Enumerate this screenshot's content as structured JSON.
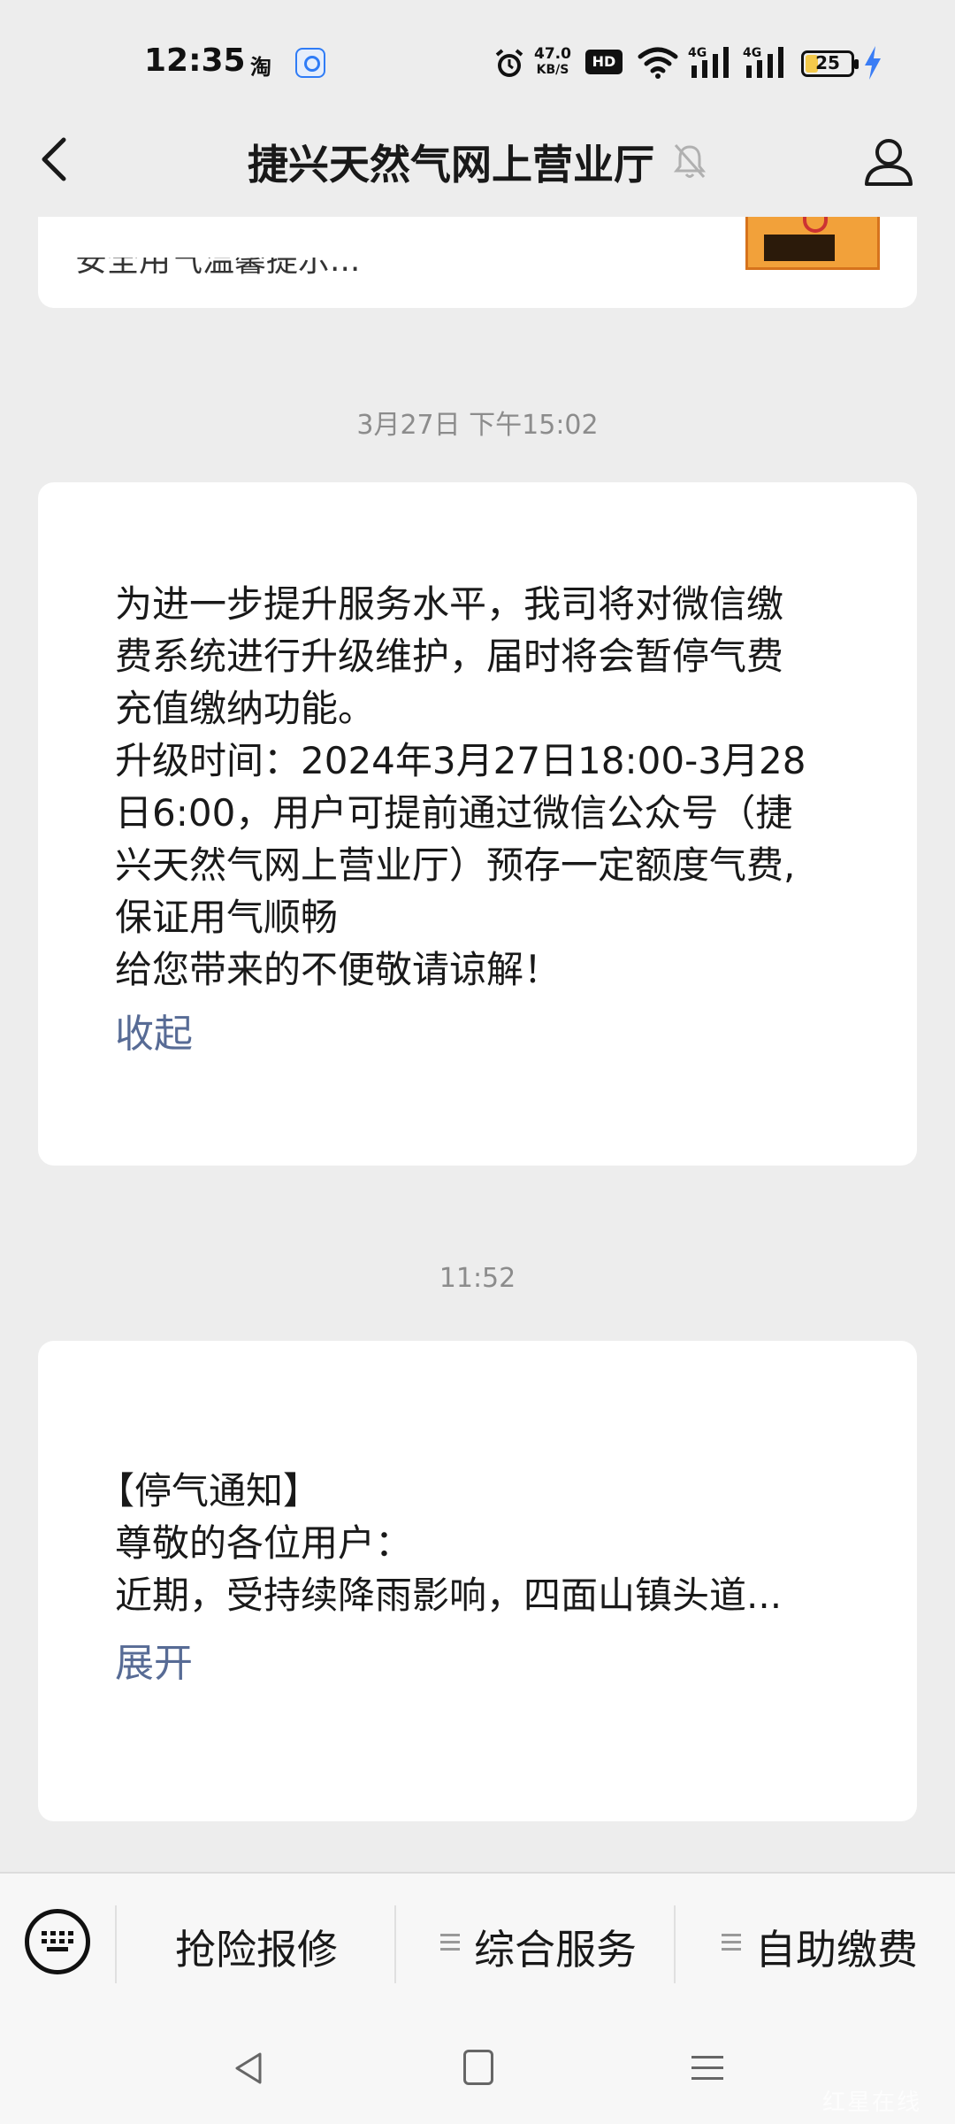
{
  "status_bar": {
    "time": "12:35",
    "taobao_label": "淘",
    "speed_value": "47.0",
    "speed_unit": "KB/S",
    "hd_label": "HD",
    "signal1_label": "4G",
    "signal2_label": "4G",
    "battery": "25"
  },
  "header": {
    "title": "捷兴天然气网上营业厅"
  },
  "feed": {
    "partial_message_text": "安全用气温馨提示...",
    "messages": [
      {
        "timestamp": "3月27日 下午15:02",
        "lines": [
          "为进一步提升服务水平，我司将对微信缴",
          "费系统进行升级维护，届时将会暂停气费",
          "充值缴纳功能。",
          "升级时间：2024年3月27日18:00-3月28",
          "日6:00，用户可提前通过微信公众号（捷",
          "兴天然气网上营业厅）预存一定额度气费,",
          "保证用气顺畅",
          "给您带来的不便敬请谅解！"
        ],
        "toggle_label": "收起"
      },
      {
        "timestamp": "11:52",
        "lines": [
          "【停气通知】",
          "尊敬的各位用户：",
          "近期，受持续降雨影响，四面山镇头道..."
        ],
        "toggle_label": "展开"
      }
    ]
  },
  "menu": {
    "item1": "抢险报修",
    "item2": "综合服务",
    "item3": "自助缴费"
  },
  "watermark": "红星在线",
  "colors": {
    "link": "#576b95",
    "background": "#ededed",
    "card": "#ffffff",
    "timestamp": "#8c8c8c"
  }
}
